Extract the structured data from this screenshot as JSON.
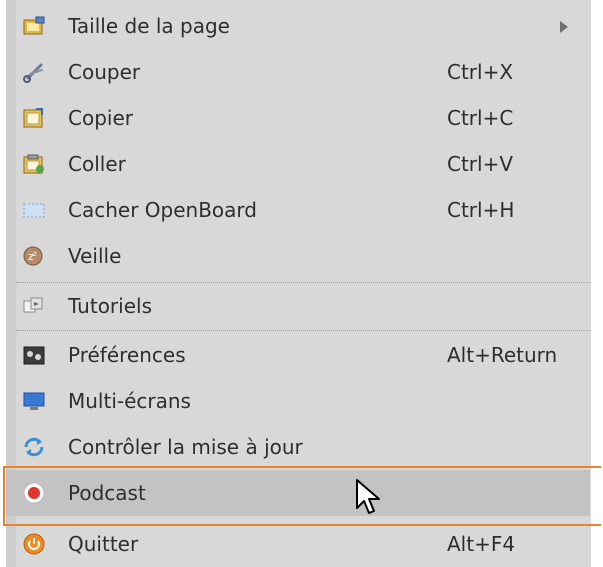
{
  "menu": {
    "items": [
      {
        "label": "Taille de la page",
        "shortcut": "",
        "icon": "page-size-icon",
        "submenu": true
      },
      {
        "label": "Couper",
        "shortcut": "Ctrl+X",
        "icon": "scissors-icon"
      },
      {
        "label": "Copier",
        "shortcut": "Ctrl+C",
        "icon": "copy-icon"
      },
      {
        "label": "Coller",
        "shortcut": "Ctrl+V",
        "icon": "paste-icon"
      },
      {
        "label": "Cacher OpenBoard",
        "shortcut": "Ctrl+H",
        "icon": "hide-window-icon"
      },
      {
        "label": "Veille",
        "shortcut": "",
        "icon": "sleep-icon"
      },
      {
        "label": "Tutoriels",
        "shortcut": "",
        "icon": "tutorials-icon"
      },
      {
        "label": "Préférences",
        "shortcut": "Alt+Return",
        "icon": "preferences-icon"
      },
      {
        "label": "Multi-écrans",
        "shortcut": "",
        "icon": "multi-screen-icon"
      },
      {
        "label": "Contrôler la mise à jour",
        "shortcut": "",
        "icon": "update-check-icon"
      },
      {
        "label": "Podcast",
        "shortcut": "",
        "icon": "record-icon",
        "highlighted": true
      },
      {
        "label": "Quitter",
        "shortcut": "Alt+F4",
        "icon": "power-icon"
      }
    ]
  },
  "colors": {
    "menu_background": "#d8d8d8",
    "hover_background": "#c3c3c3",
    "annotation_outline": "#e8842c",
    "record_red": "#e0362b"
  }
}
